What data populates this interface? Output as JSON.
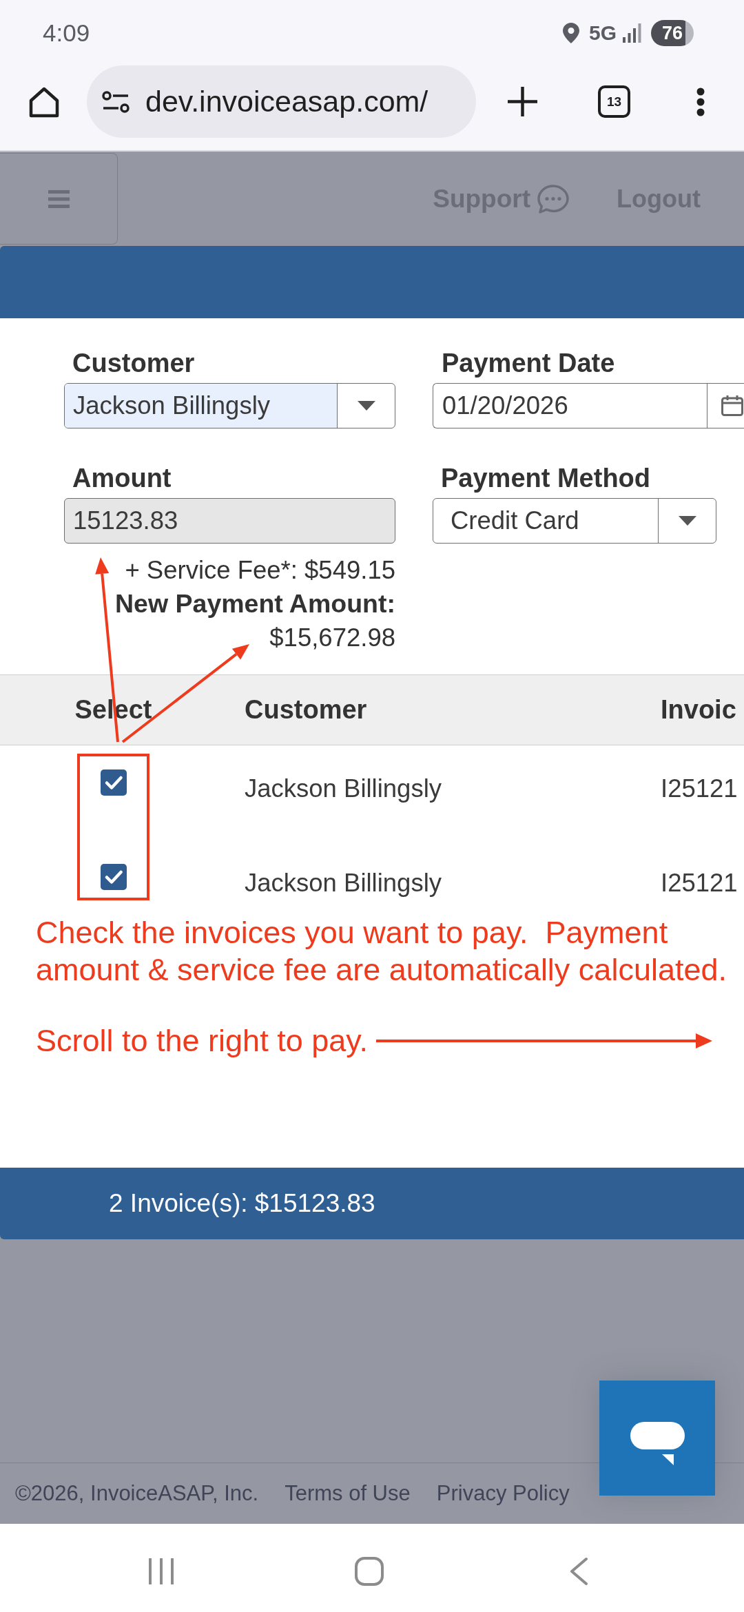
{
  "status_bar": {
    "time": "4:09",
    "network": "5G",
    "battery": "76"
  },
  "browser": {
    "url": "dev.invoiceasap.com/",
    "tab_count": "13"
  },
  "app_header": {
    "support": "Support",
    "logout": "Logout"
  },
  "payment_form": {
    "fields": [
      {
        "kind": "select",
        "label": "Customer",
        "value": "Jackson Billingsly",
        "autofilled": true,
        "disabled": false
      },
      {
        "kind": "date",
        "label": "Payment Date",
        "value": "01/20/2026",
        "autofilled": false,
        "disabled": false
      },
      {
        "kind": "text",
        "label": "Amount",
        "value": "15123.83",
        "autofilled": false,
        "disabled": true
      },
      {
        "kind": "select",
        "label": "Payment Method",
        "value": "Credit Card",
        "autofilled": false,
        "disabled": false
      }
    ],
    "service_fee": "+ Service Fee*: $549.15",
    "new_amount_label": "New Payment Amount:",
    "new_amount_value": "$15,672.98"
  },
  "table": {
    "columns": [
      "Select",
      "Customer",
      "Invoic"
    ],
    "rows": [
      {
        "selected": true,
        "customer": "Jackson Billingsly",
        "invoice": "I25121"
      },
      {
        "selected": true,
        "customer": "Jackson Billingsly",
        "invoice": "I25121"
      }
    ]
  },
  "annotation": {
    "instructions": "Check the invoices you want to pay.  Payment amount & service fee are automatically calculated.",
    "scroll_hint": "Scroll to the right to pay."
  },
  "summary_bar": {
    "text": "2 Invoice(s): $15123.83"
  },
  "footer": {
    "copyright": "©2026, InvoiceASAP, Inc.",
    "links": [
      "Terms of Use",
      "Privacy Policy"
    ]
  }
}
